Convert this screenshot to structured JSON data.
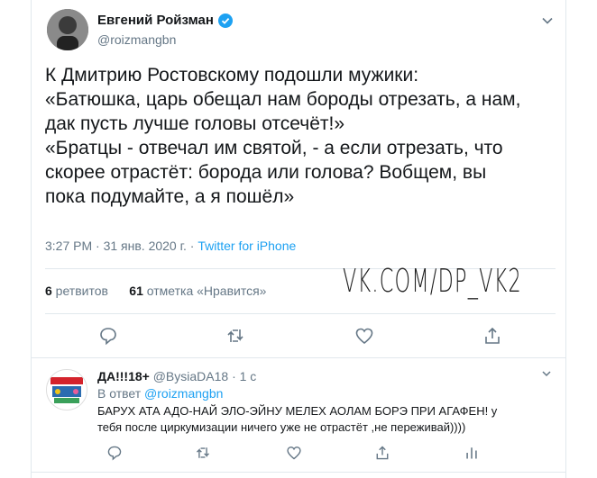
{
  "tweet": {
    "author_name": "Евгений Ройзман",
    "author_handle": "@roizmangbn",
    "text": "К Дмитрию Ростовскому подошли мужики:\n«Батюшка, царь обещал нам бороды отрезать, а нам,\nдак пусть лучше головы отсечёт!»\n«Братцы - отвечал им святой, - а если отрезать, что\nскорее отрастёт: борода или голова? Вобщем, вы\nпока подумайте, а я пошёл»",
    "time": "3:27 PM · 31 янв. 2020 г. · ",
    "source": "Twitter for iPhone",
    "retweets_count": "6",
    "retweets_label": " ретвитов",
    "likes_count": "61",
    "likes_label": " отметка «Нравится»"
  },
  "watermark": "VK.COM/DP_VK2",
  "reply": {
    "author_name": "ДА!!!18+",
    "author_handle": " @BysiaDA18 · 1 с",
    "reply_to_prefix": "В ответ ",
    "reply_to_handle": "@roizmangbn",
    "text": "БАРУХ АТА АДО-НАЙ ЭЛО-ЭЙНУ МЕЛЕХ АОЛАМ БОРЭ ПРИ АГАФЕН! у\nтебя после циркумизации ничего уже не отрастёт ,не переживай))))"
  },
  "colors": {
    "accent": "#1da1f2",
    "secondary_text": "#657786",
    "divider": "#e1e8ed"
  },
  "icons": {
    "verified": "verified-badge-icon",
    "more": "chevron-down-icon",
    "reply": "reply-icon",
    "retweet": "retweet-icon",
    "like": "heart-icon",
    "share": "share-icon",
    "analytics": "analytics-icon"
  }
}
